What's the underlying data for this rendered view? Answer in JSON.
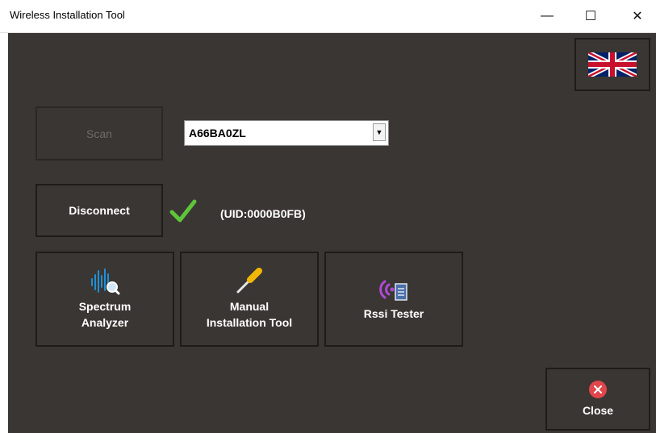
{
  "window": {
    "title": "Wireless Installation Tool",
    "minimize_glyph": "—",
    "maximize_glyph": "☐",
    "close_glyph": "✕"
  },
  "language": {
    "flag_icon": "uk-flag-icon"
  },
  "scan": {
    "label": "Scan",
    "enabled": false
  },
  "device_select": {
    "value": "A66BA0ZL",
    "arrow_glyph": "▼"
  },
  "connection": {
    "disconnect_label": "Disconnect",
    "status_icon": "checkmark-icon",
    "uid": "(UID:0000B0FB)"
  },
  "tools": [
    {
      "label": "Spectrum\nAnalyzer",
      "icon": "spectrum-analyzer-icon"
    },
    {
      "label": "Manual\nInstallation Tool",
      "icon": "screwdriver-icon"
    },
    {
      "label": "Rssi Tester",
      "icon": "rssi-tester-icon"
    }
  ],
  "close": {
    "label": "Close",
    "icon": "close-circle-icon"
  },
  "colors": {
    "background": "#3a3633",
    "border": "#1e1c1a",
    "check": "#5ec43a",
    "close_red": "#e0474c",
    "accent_blue": "#1e90d6",
    "accent_purple": "#b04ad8"
  }
}
